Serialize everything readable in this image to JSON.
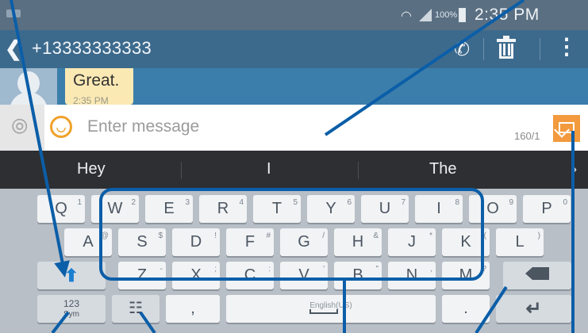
{
  "status_bar": {
    "battery": "100%",
    "time": "2:35 PM"
  },
  "header": {
    "recipient": "+13333333333"
  },
  "conversation": {
    "message": "Great.",
    "time": "2:35 PM"
  },
  "composer": {
    "placeholder": "Enter message",
    "counter": "160/1"
  },
  "suggestions": [
    "Hey",
    "I",
    "The"
  ],
  "keyboard": {
    "row1": [
      {
        "label": "Q",
        "sup": "1"
      },
      {
        "label": "W",
        "sup": "2"
      },
      {
        "label": "E",
        "sup": "3"
      },
      {
        "label": "R",
        "sup": "4"
      },
      {
        "label": "T",
        "sup": "5"
      },
      {
        "label": "Y",
        "sup": "6"
      },
      {
        "label": "U",
        "sup": "7"
      },
      {
        "label": "I",
        "sup": "8"
      },
      {
        "label": "O",
        "sup": "9"
      },
      {
        "label": "P",
        "sup": "0"
      }
    ],
    "row2": [
      {
        "label": "A",
        "sup": "@"
      },
      {
        "label": "S",
        "sup": "$"
      },
      {
        "label": "D",
        "sup": "!"
      },
      {
        "label": "F",
        "sup": "#"
      },
      {
        "label": "G",
        "sup": "/"
      },
      {
        "label": "H",
        "sup": "&"
      },
      {
        "label": "J",
        "sup": "*"
      },
      {
        "label": "K",
        "sup": "("
      },
      {
        "label": "L",
        "sup": ")"
      }
    ],
    "row3": [
      {
        "label": "Z",
        "sup": "-"
      },
      {
        "label": "X",
        "sup": ";"
      },
      {
        "label": "C",
        "sup": ":"
      },
      {
        "label": "V",
        "sup": "'"
      },
      {
        "label": "B",
        "sup": "\""
      },
      {
        "label": "N",
        "sup": ","
      },
      {
        "label": "M",
        "sup": "?"
      }
    ],
    "sym_top": "123",
    "sym_bottom": "Sym",
    "comma": ",",
    "space_label": "English(US)",
    "period": "."
  },
  "icons": {
    "back": "back-arrow-icon",
    "call": "phone-icon",
    "delete": "trash-icon",
    "more": "more-vertical-icon",
    "attach": "paperclip-icon",
    "emoji": "emoji-icon",
    "send": "send-icon",
    "shift": "shift-icon",
    "backspace": "backspace-icon",
    "enter": "enter-icon",
    "voice": "voice-input-icon"
  },
  "colors": {
    "annotation": "#0b5ea8",
    "send": "#f29a3d",
    "header": "#3c6a8d"
  }
}
